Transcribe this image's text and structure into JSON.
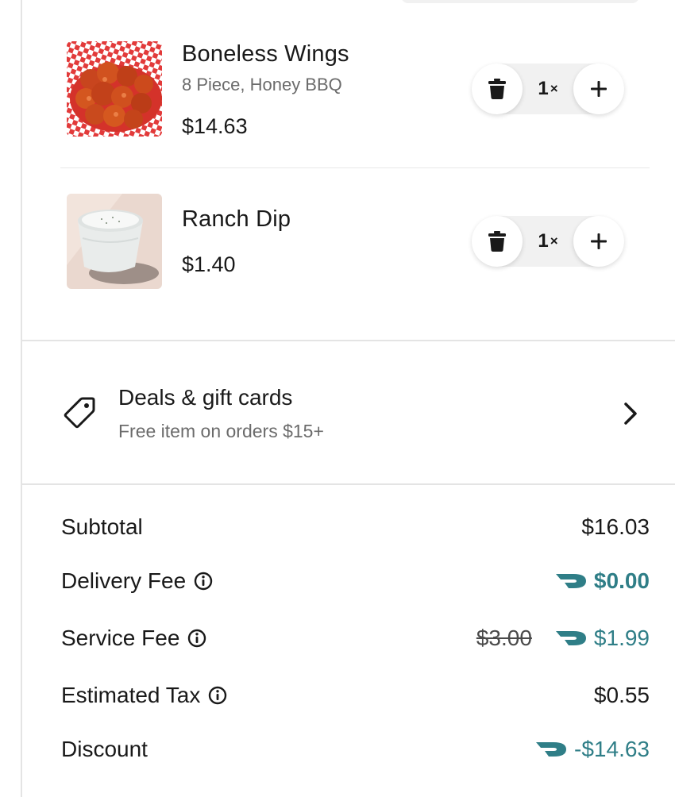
{
  "cart": {
    "items": [
      {
        "name": "Boneless Wings",
        "options": "8 Piece, Honey BBQ",
        "price": "$14.63",
        "quantity": "1",
        "quantity_suffix": "×",
        "image": "boneless-wings-photo"
      },
      {
        "name": "Ranch Dip",
        "price": "$1.40",
        "quantity": "1",
        "quantity_suffix": "×",
        "image": "ranch-dip-photo"
      }
    ]
  },
  "deals": {
    "title": "Deals & gift cards",
    "subtitle": "Free item on orders $15+",
    "icon": "tag-icon"
  },
  "summary": {
    "subtotal": {
      "label": "Subtotal",
      "value": "$16.03"
    },
    "delivery_fee": {
      "label": "Delivery Fee",
      "value": "$0.00"
    },
    "service_fee": {
      "label": "Service Fee",
      "original_value": "$3.00",
      "value": "$1.99"
    },
    "estimated_tax": {
      "label": "Estimated Tax",
      "value": "$0.55"
    },
    "discount": {
      "label": "Discount",
      "value": "-$14.63"
    }
  },
  "colors": {
    "accent_teal": "#2f7e87",
    "text_primary": "#191919",
    "text_secondary": "#6b6b6b",
    "stepper_bg": "#f1f1f1"
  }
}
